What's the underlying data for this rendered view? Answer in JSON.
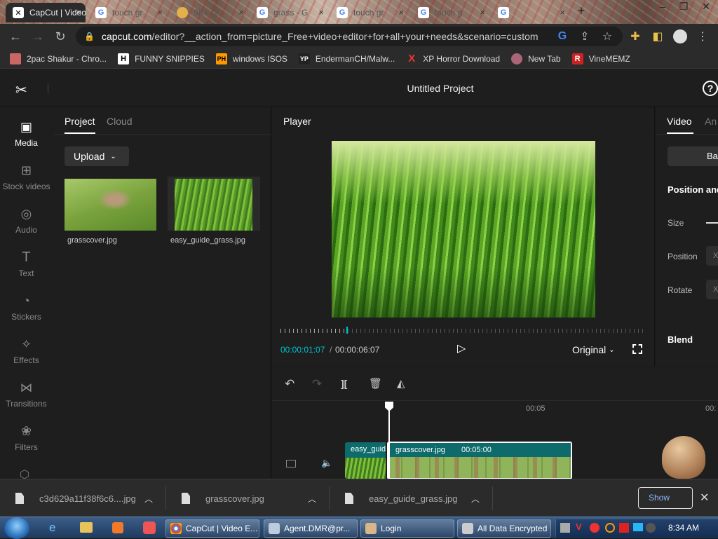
{
  "browser": {
    "tabs": [
      {
        "title": "CapCut | Video E",
        "active": true
      },
      {
        "title": "touch gr"
      },
      {
        "title": "9K+ (2"
      },
      {
        "title": "grass - G"
      },
      {
        "title": "touch gr"
      },
      {
        "title": "touch g"
      },
      {
        "title": ""
      }
    ],
    "url_host": "capcut.com",
    "url_rest": "/editor?__action_from=picture_Free+video+editor+for+all+your+needs&scenario=custom",
    "bookmarks": [
      {
        "label": "2pac Shakur - Chro...",
        "icon": "bookmark-icon"
      },
      {
        "label": "FUNNY SNIPPIES",
        "icon": "H"
      },
      {
        "label": "windows ISOS",
        "icon": "PH"
      },
      {
        "label": "EndermanCH/Malw...",
        "icon": "YP"
      },
      {
        "label": "XP Horror Download",
        "icon": "X"
      },
      {
        "label": "New Tab",
        "icon": "globe-icon"
      },
      {
        "label": "VineMEMZ",
        "icon": "R"
      }
    ]
  },
  "app": {
    "project_title": "Untitled Project",
    "rail": [
      {
        "label": "Media",
        "active": true
      },
      {
        "label": "Stock videos"
      },
      {
        "label": "Audio"
      },
      {
        "label": "Text"
      },
      {
        "label": "Stickers"
      },
      {
        "label": "Effects"
      },
      {
        "label": "Transitions"
      },
      {
        "label": "Filters"
      }
    ],
    "media_tabs": [
      "Project",
      "Cloud"
    ],
    "upload_label": "Upload",
    "media_items": [
      {
        "name": "grasscover.jpg"
      },
      {
        "name": "easy_guide_grass.jpg"
      }
    ],
    "player": {
      "title": "Player",
      "time_current": "00:00:01:07",
      "time_sep": "/",
      "time_total": "00:00:06:07",
      "ratio_label": "Original"
    },
    "right_panel": {
      "tabs": [
        "Video",
        "An"
      ],
      "basic_btn": "Ba",
      "section_title": "Position and",
      "size_label": "Size",
      "position_label": "Position",
      "rotate_label": "Rotate",
      "x_label": "X",
      "blend_label": "Blend"
    },
    "timeline": {
      "ruler_marks": [
        "00:05",
        "00:"
      ],
      "clip1_label": "easy_guid",
      "clip2_label": "grasscover.jpg",
      "clip2_duration": "00:05:00"
    }
  },
  "downloads": {
    "items": [
      "c3d629a11f38f6c6....jpg",
      "grasscover.jpg",
      "easy_guide_grass.jpg"
    ],
    "show_all": "Show"
  },
  "taskbar": {
    "items": [
      "CapCut | Video E...",
      "Agent.DMR@pr...",
      "Login",
      "All Data Encrypted"
    ],
    "clock": "8:34 AM"
  },
  "colors": {
    "accent": "#00c1cd",
    "clip": "#0e6b6b",
    "bg": "#1e1e1e"
  }
}
